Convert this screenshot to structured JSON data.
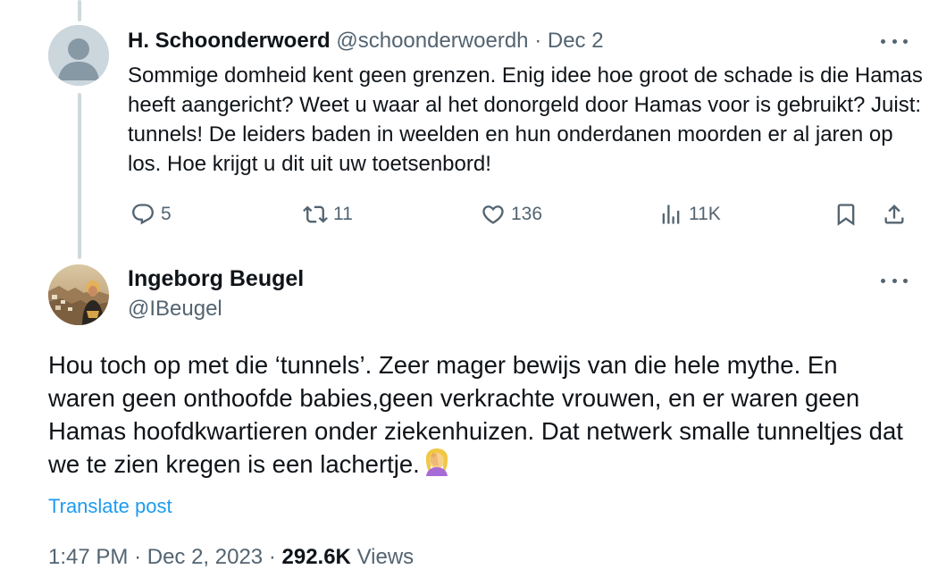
{
  "reply": {
    "name": "H. Schoonderwoerd",
    "handle": "@schoonderwoerdh",
    "separator": "·",
    "date": "Dec 2",
    "text": "Sommige domheid kent geen grenzen. Enig idee hoe groot de schade is die Hamas heeft aangericht? Weet u waar al het donorgeld door Hamas voor is gebruikt? Juist: tunnels! De leiders baden in weelden en hun onderdanen moorden er al jaren op los. Hoe krijgt u dit uit uw toetsenbord!",
    "stats": {
      "replies": "5",
      "reposts": "11",
      "likes": "136",
      "views": "11K"
    },
    "icons": [
      "reply-icon",
      "repost-icon",
      "like-icon",
      "views-icon",
      "bookmark-icon",
      "share-icon"
    ]
  },
  "main_post": {
    "name": "Ingeborg Beugel",
    "handle": "@IBeugel",
    "text": "Hou toch op met die ‘tunnels’. Zeer mager bewijs van die hele mythe. En waren geen onthoofde babies,geen verkrachte vrouwen, en er waren geen Hamas hoofdkwartieren onder ziekenhuizen. Dat netwerk smalle tunneltjes dat we te zien kregen is een lachertje.",
    "emoji": "woman-facepalming",
    "translate_label": "Translate post",
    "timestamp": "1:47 PM",
    "separator1": "·",
    "date": "Dec 2, 2023",
    "separator2": "·",
    "views_count": "292.6K",
    "views_label": "Views"
  },
  "colors": {
    "text": "#0f1419",
    "secondary": "#536471",
    "link": "#1d9bf0",
    "thread_line": "#cfd9de"
  }
}
